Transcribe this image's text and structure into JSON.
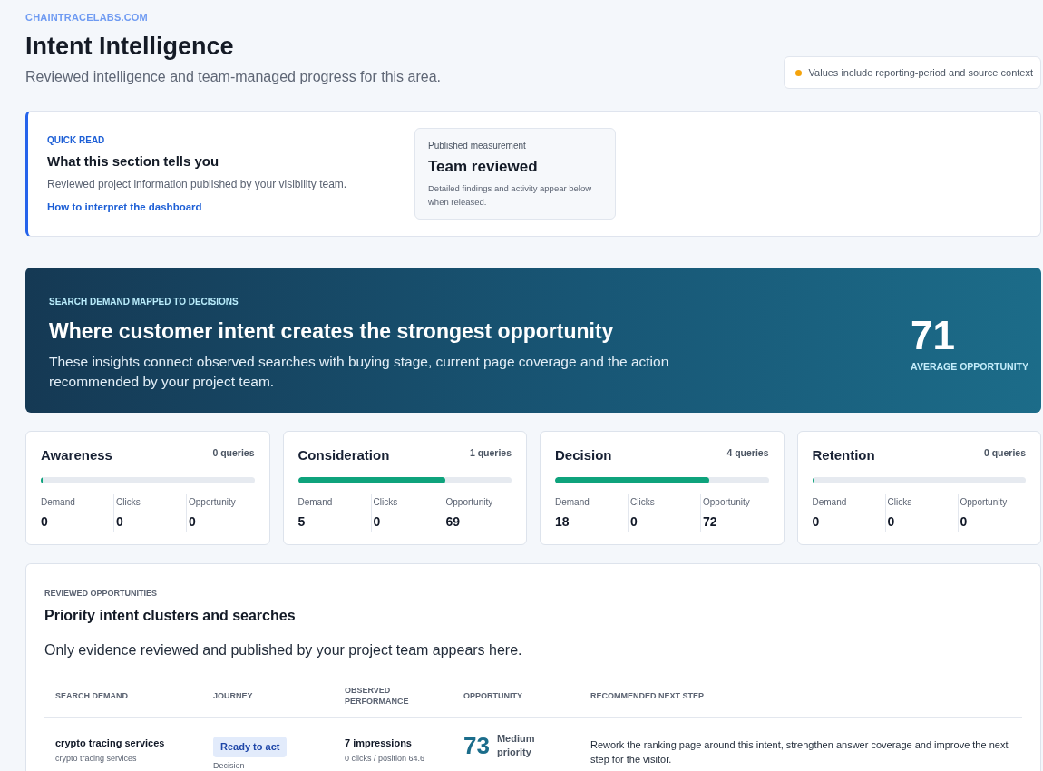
{
  "site": {
    "domain": "CHAINTRACELABS.COM"
  },
  "header": {
    "title": "Intent Intelligence",
    "subtitle": "Reviewed intelligence and team-managed progress for this area.",
    "notice": "Values include reporting-period and source context"
  },
  "quick_read": {
    "label": "QUICK READ",
    "title": "What this section tells you",
    "description": "Reviewed project information published by your visibility team.",
    "link": "How to interpret the dashboard",
    "measurement": {
      "label": "Published measurement",
      "value": "Team reviewed",
      "note": "Detailed findings and activity appear below when released."
    }
  },
  "banner": {
    "label": "SEARCH DEMAND MAPPED TO DECISIONS",
    "title": "Where customer intent creates the strongest opportunity",
    "description": "These insights connect observed searches with buying stage, current page coverage and the action recommended by your project team.",
    "stat": {
      "value": "71",
      "label": "AVERAGE OPPORTUNITY"
    }
  },
  "stages": [
    {
      "name": "Awareness",
      "queries": "0 queries",
      "level": 0,
      "metrics": [
        {
          "label": "Demand",
          "value": "0"
        },
        {
          "label": "Clicks",
          "value": "0"
        },
        {
          "label": "Opportunity",
          "value": "0"
        }
      ]
    },
    {
      "name": "Consideration",
      "queries": "1 queries",
      "level": 0.69,
      "metrics": [
        {
          "label": "Demand",
          "value": "5"
        },
        {
          "label": "Clicks",
          "value": "0"
        },
        {
          "label": "Opportunity",
          "value": "69"
        }
      ]
    },
    {
      "name": "Decision",
      "queries": "4 queries",
      "level": 0.72,
      "metrics": [
        {
          "label": "Demand",
          "value": "18"
        },
        {
          "label": "Clicks",
          "value": "0"
        },
        {
          "label": "Opportunity",
          "value": "72"
        }
      ]
    },
    {
      "name": "Retention",
      "queries": "0 queries",
      "level": 0,
      "metrics": [
        {
          "label": "Demand",
          "value": "0"
        },
        {
          "label": "Clicks",
          "value": "0"
        },
        {
          "label": "Opportunity",
          "value": "0"
        }
      ]
    }
  ],
  "opportunities": {
    "label": "REVIEWED OPPORTUNITIES",
    "title": "Priority intent clusters and searches",
    "description": "Only evidence reviewed and published by your project team appears here.",
    "table": {
      "columns": [
        "SEARCH DEMAND",
        "JOURNEY",
        "OBSERVED PERFORMANCE",
        "OPPORTUNITY",
        "RECOMMENDED NEXT STEP"
      ],
      "rows": [
        {
          "search": "crypto tracing services",
          "search_detail": "crypto tracing services",
          "journey": {
            "status": "Ready to act",
            "stage": "Decision"
          },
          "performance": {
            "impressions": "7 impressions",
            "detail": "0 clicks / position 64.6"
          },
          "opportunity": {
            "score": "73",
            "priority": "Medium priority"
          },
          "next_step": "Rework the ranking page around this intent, strengthen answer coverage and improve the next step for the visitor."
        }
      ]
    }
  }
}
